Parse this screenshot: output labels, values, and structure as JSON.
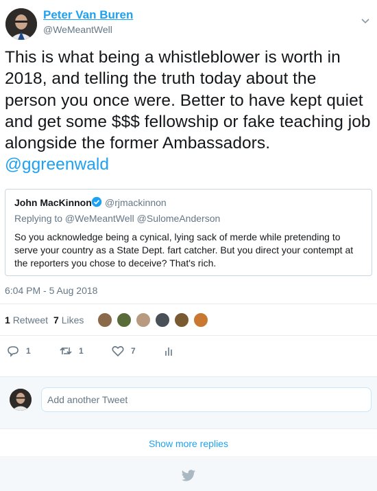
{
  "tweet": {
    "display_name": "Peter Van Buren",
    "username": "@WeMeantWell",
    "text_plain": "This is what being a whistleblower is worth in 2018, and telling the truth today about the person you once were. Better to have kept quiet and get some $$$ fellowship or fake teaching job alongside the former Ambassadors. ",
    "text_mention": "@ggreenwald",
    "timestamp": "6:04 PM - 5 Aug 2018",
    "icons": {
      "menu": "chevron-down-icon",
      "verified": "verified-badge-icon"
    }
  },
  "quote": {
    "name": "John MacKinnon",
    "handle": "@rjmackinnon",
    "replying_to": "Replying to @WeMeantWell @SulomeAnderson",
    "body": "So you acknowledge being a cynical, lying sack of merde while pretending to serve your country as a State Dept. fart catcher. But you direct your contempt at the reporters you chose to deceive? That's rich."
  },
  "stats": {
    "retweet_count": "1",
    "retweet_label": "Retweet",
    "like_count": "7",
    "like_label": "Likes",
    "liker_colors": [
      "#8a6a4a",
      "#5a6b3a",
      "#b89a80",
      "#4a5058",
      "#7a5a30",
      "#c87830"
    ]
  },
  "actions": {
    "reply_count": "1",
    "retweet_count": "1",
    "like_count": "7",
    "icons": [
      "reply-icon",
      "retweet-icon",
      "heart-icon",
      "analytics-icon"
    ]
  },
  "reply_box": {
    "placeholder": "Add another Tweet"
  },
  "show_more": "Show more replies",
  "colors": {
    "accent": "#1da1f2",
    "text": "#14171a",
    "muted": "#657786",
    "border": "#e6ecf0"
  }
}
